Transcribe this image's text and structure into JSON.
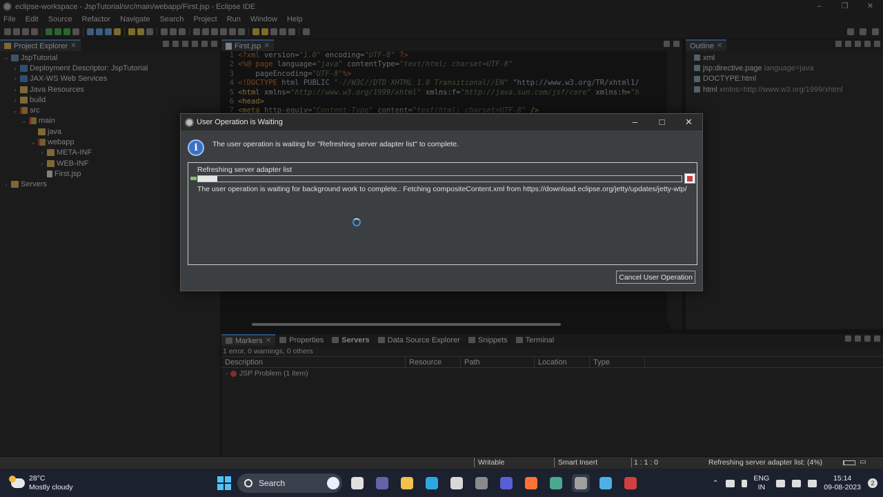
{
  "window": {
    "title": "eclipse-workspace - JspTutorial/src/main/webapp/First.jsp - Eclipse IDE",
    "controls": [
      "–",
      "❐",
      "✕"
    ]
  },
  "menu": [
    "File",
    "Edit",
    "Source",
    "Refactor",
    "Navigate",
    "Search",
    "Project",
    "Run",
    "Window",
    "Help"
  ],
  "project_explorer": {
    "tab": "Project Explorer",
    "items": [
      {
        "label": "JspTutorial",
        "icon": "project-icon",
        "depth": 0,
        "expanded": true
      },
      {
        "label": "Deployment Descriptor: JspTutorial",
        "icon": "descriptor-icon",
        "depth": 1,
        "expanded": false
      },
      {
        "label": "JAX-WS Web Services",
        "icon": "webservice-icon",
        "depth": 1,
        "expanded": false
      },
      {
        "label": "Java Resources",
        "icon": "folder-icon",
        "depth": 1,
        "expanded": false
      },
      {
        "label": "build",
        "icon": "folder-icon",
        "depth": 1,
        "expanded": false
      },
      {
        "label": "src",
        "icon": "source-folder-icon",
        "depth": 1,
        "expanded": true
      },
      {
        "label": "main",
        "icon": "source-folder-icon",
        "depth": 2,
        "expanded": true
      },
      {
        "label": "java",
        "icon": "folder-icon",
        "depth": 3,
        "expanded": null
      },
      {
        "label": "webapp",
        "icon": "source-folder-icon",
        "depth": 3,
        "expanded": true
      },
      {
        "label": "META-INF",
        "icon": "folder-icon",
        "depth": 4,
        "expanded": false
      },
      {
        "label": "WEB-INF",
        "icon": "folder-icon",
        "depth": 4,
        "expanded": false
      },
      {
        "label": "First.jsp",
        "icon": "jsp-file-icon",
        "depth": 4,
        "expanded": null
      },
      {
        "label": "Servers",
        "icon": "folder-icon",
        "depth": 0,
        "expanded": false
      }
    ]
  },
  "editor": {
    "tab": "First.jsp",
    "lines": [
      {
        "no": "1",
        "html": "<span class=\"kw\">&lt;?xml</span> <span class=\"at\">version=</span><span class=\"str\">\"1.0\"</span> <span class=\"at\">encoding=</span><span class=\"str\">\"UTF-8\"</span> <span class=\"kw\">?&gt;</span>"
      },
      {
        "no": "2",
        "html": "<span class=\"kw\">&lt;%@ page</span> <span class=\"at\">language=</span><span class=\"str\">\"java\"</span> <span class=\"at\">contentType=</span><span class=\"str\">\"text/html; charset=UTF-8\"</span>"
      },
      {
        "no": "3",
        "html": "    <span class=\"at\">pageEncoding=</span><span class=\"str\">\"UTF-8\"</span><span class=\"kw\">%&gt;</span>"
      },
      {
        "no": "4",
        "html": "<span class=\"kw\">&lt;!DOCTYPE</span> <span class=\"txt\">html PUBLIC</span> <span class=\"str\">\"-//W3C//DTD XHTML 1.0 Transitional//EN\"</span> <span class=\"txt\">\"http://www.w3.org/TR/xhtml1/</span>"
      },
      {
        "no": "5",
        "html": "<span class=\"tag\">&lt;html</span> <span class=\"at\">xmlns=</span><span class=\"str\">\"http://www.w3.org/1999/xhtml\"</span> <span class=\"at\">xmlns:f=</span><span class=\"str\">\"http://java.sun.com/jsf/core\"</span> <span class=\"at\">xmlns:h=</span><span class=\"str\">\"h</span>"
      },
      {
        "no": "6",
        "html": "<span class=\"tag\">&lt;head&gt;</span>"
      },
      {
        "no": "7",
        "html": "<span class=\"tag\">&lt;meta</span> <span class=\"at\">http-equiv=</span><span class=\"str\">\"Content-Type\"</span> <span class=\"at\">content=</span><span class=\"str\">\"text/html; charset=UTF-8\"</span> <span class=\"tag\">/&gt;</span>"
      }
    ]
  },
  "outline": {
    "tab": "Outline",
    "items": [
      {
        "label": "xml",
        "extra": ""
      },
      {
        "label": "jsp:directive.page",
        "extra": "language=java"
      },
      {
        "label": "DOCTYPE:html",
        "extra": ""
      },
      {
        "label": "html",
        "extra": "xmlns=http://www.w3.org/1999/xhtml"
      }
    ]
  },
  "bottom": {
    "tabs": [
      {
        "label": "Markers",
        "active": true
      },
      {
        "label": "Properties",
        "active": false
      },
      {
        "label": "Servers",
        "active": false
      },
      {
        "label": "Data Source Explorer",
        "active": false
      },
      {
        "label": "Snippets",
        "active": false
      },
      {
        "label": "Terminal",
        "active": false
      }
    ],
    "summary": "1 error, 0 warnings, 0 others",
    "columns": [
      "Description",
      "Resource",
      "Path",
      "Location",
      "Type"
    ],
    "rows": [
      "JSP Problem (1 item)"
    ]
  },
  "dialog": {
    "title": "User Operation is Waiting",
    "message": "The user operation is waiting for \"Refreshing server adapter list\" to complete.",
    "job_name": "Refreshing server adapter list",
    "progress_fraction": 0.04,
    "job_detail": "The user operation is waiting for background work to complete.: Fetching compositeContent.xml from https://download.eclipse.org/jetty/updates/jetty-wtp/",
    "cancel_label": "Cancel User Operation"
  },
  "statusbar": {
    "writable": "Writable",
    "insert_mode": "Smart Insert",
    "position": "1 : 1 : 0",
    "job": "Refreshing server adapter list: (4%)"
  },
  "taskbar": {
    "weather_temp": "28°C",
    "weather_desc": "Mostly cloudy",
    "search_label": "Search",
    "lang_top": "ENG",
    "lang_bottom": "IN",
    "time": "15:14",
    "date": "09-08-2023",
    "notifications": "2",
    "apps": [
      {
        "name": "task-view-icon",
        "color": "#e0e0e0"
      },
      {
        "name": "teams-icon",
        "color": "#6264a7"
      },
      {
        "name": "file-explorer-icon",
        "color": "#f2c14e"
      },
      {
        "name": "edge-icon",
        "color": "#2ea7e0"
      },
      {
        "name": "store-icon",
        "color": "#d8d8d8"
      },
      {
        "name": "obs-icon",
        "color": "#8a8a8a"
      },
      {
        "name": "vscode-style-icon",
        "color": "#5a5fd6"
      },
      {
        "name": "firefox-icon",
        "color": "#ff7139"
      },
      {
        "name": "chatgpt-icon",
        "color": "#4aa88f"
      },
      {
        "name": "eclipse-icon",
        "color": "#a0a0a0"
      },
      {
        "name": "notepad-icon",
        "color": "#4fb0e8"
      },
      {
        "name": "recorder-icon",
        "color": "#d04040"
      }
    ]
  }
}
